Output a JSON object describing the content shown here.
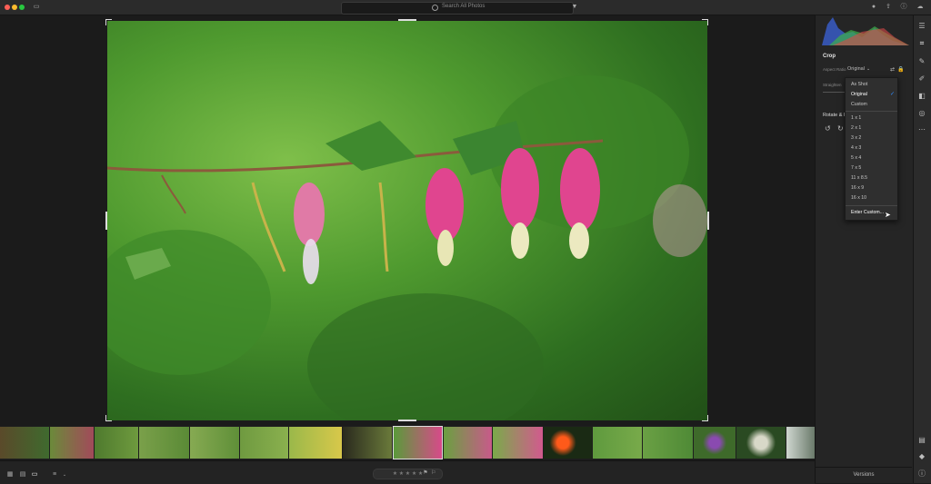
{
  "topbar": {
    "search_placeholder": "Search All Photos"
  },
  "crop_panel": {
    "title": "Crop",
    "aspect_ratio_label": "Aspect Ratio",
    "aspect_ratio_value": "Original",
    "straighten_label": "Straighten",
    "rotate_label": "Rotate & Flip"
  },
  "aspect_menu": {
    "items_top": [
      "As Shot",
      "Original",
      "Custom"
    ],
    "selected": "Original",
    "ratios": [
      "1 x 1",
      "2 x 1",
      "3 x 2",
      "4 x 3",
      "5 x 4",
      "7 x 5",
      "11 x 8.5",
      "16 x 9",
      "16 x 10"
    ],
    "enter_custom": "Enter Custom..."
  },
  "bottom": {
    "stars": "★ ★ ★ ★ ★",
    "versions": "Versions"
  },
  "colors": {
    "window_bg": "#1b1b1b",
    "panel_bg": "#252525",
    "accent": "#2f8cff",
    "flower_pink": "#e0458f"
  }
}
